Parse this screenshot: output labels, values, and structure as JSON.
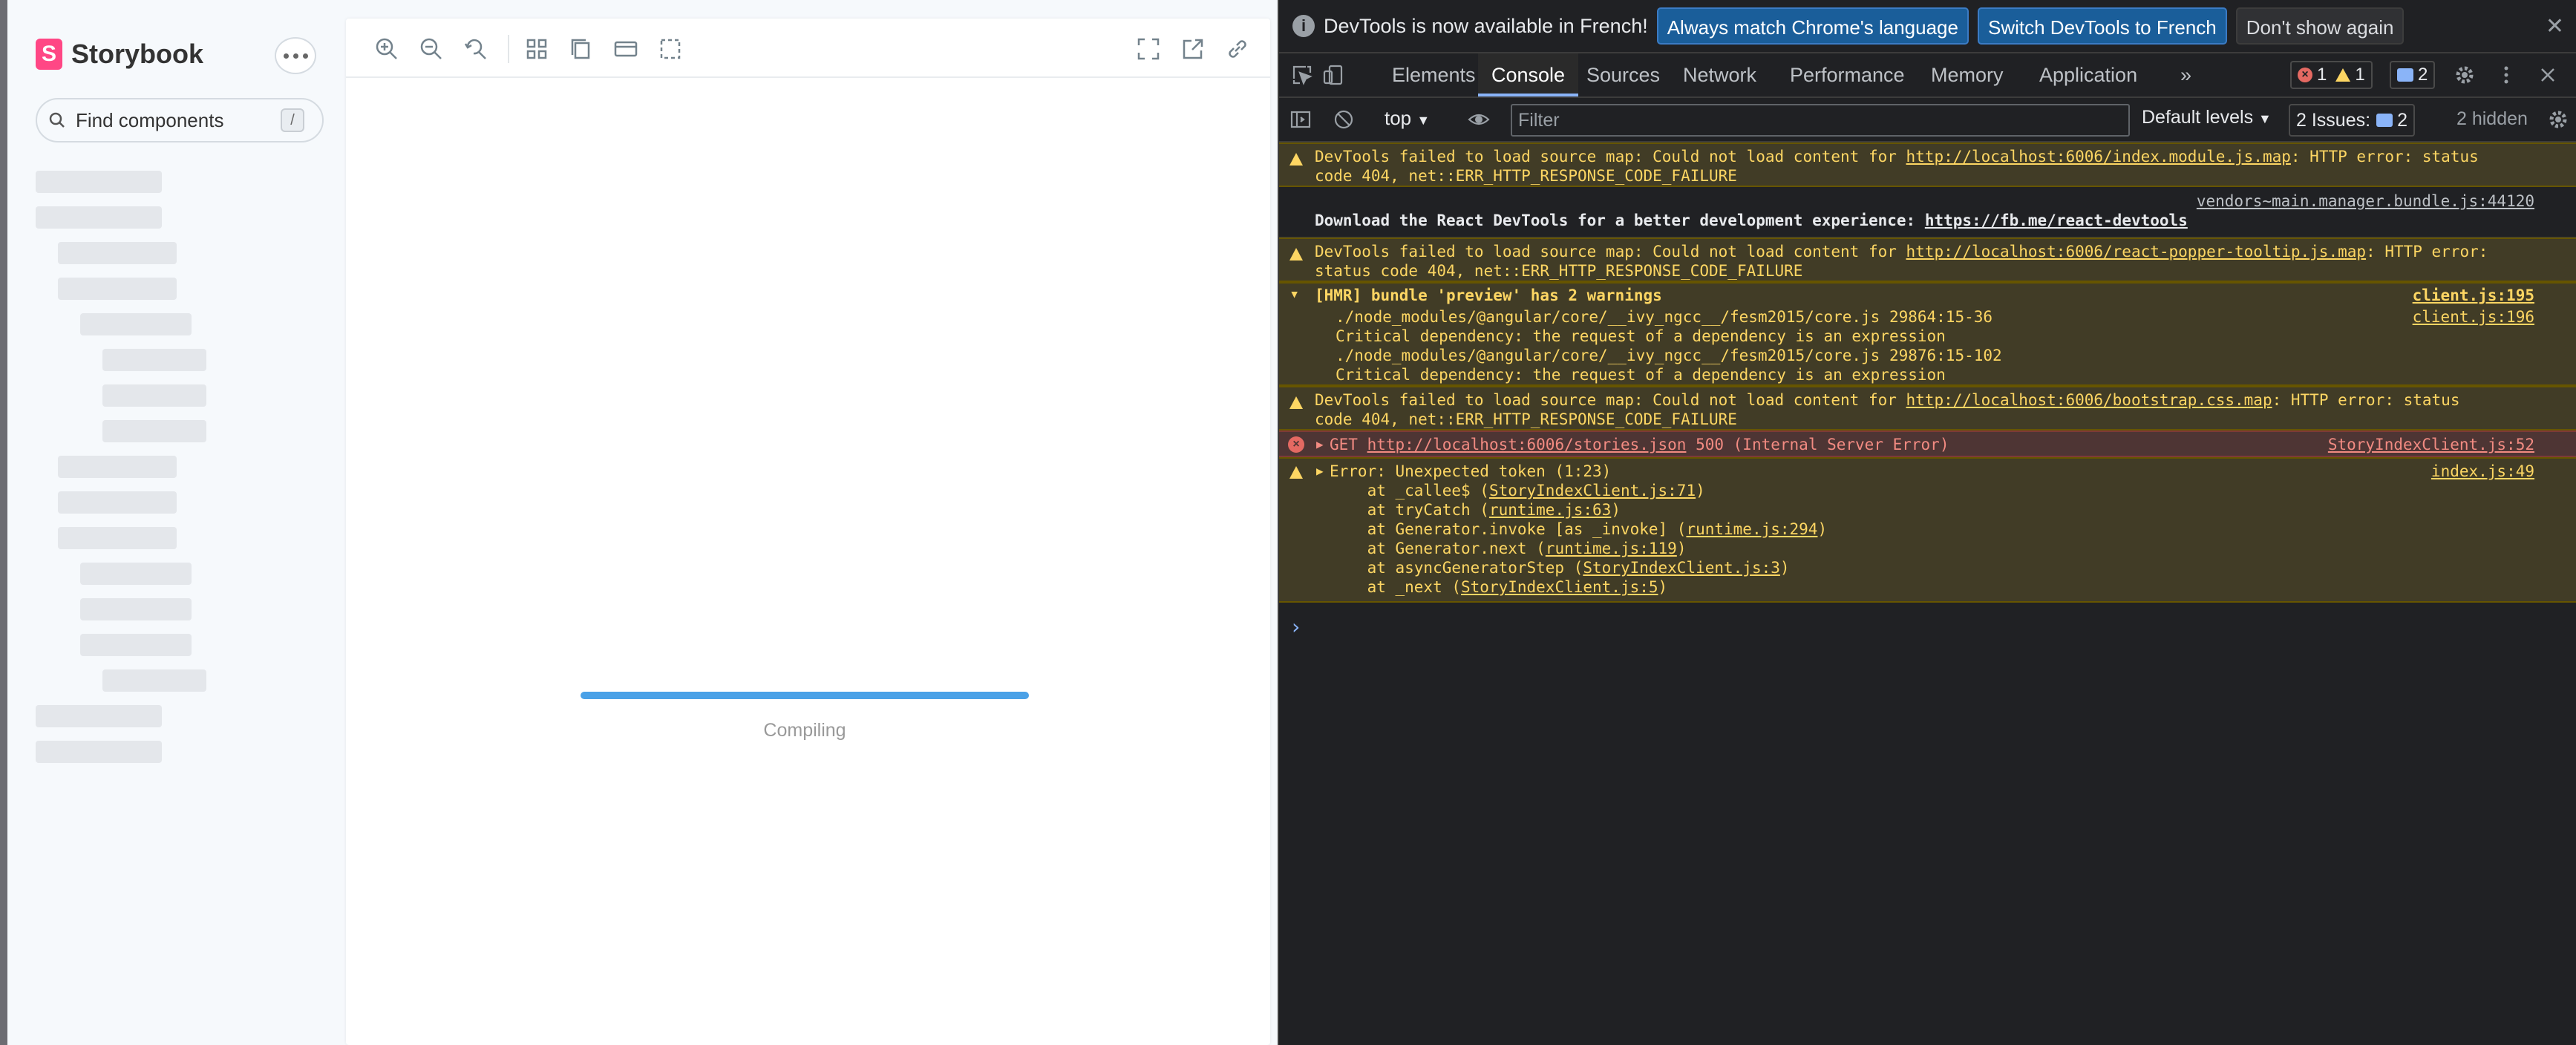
{
  "storybook": {
    "brand": "Storybook",
    "logo_letter": "S",
    "search_placeholder": "Find components",
    "search_shortcut": "/",
    "compiling": "Compiling",
    "progress": 1.0
  },
  "devtools": {
    "info_text": "DevTools is now available in French!",
    "info_btn_match": "Always match Chrome's language",
    "info_btn_switch": "Switch DevTools to French",
    "info_btn_dismiss": "Don't show again",
    "tabs": [
      "Elements",
      "Console",
      "Sources",
      "Network",
      "Performance",
      "Memory",
      "Application"
    ],
    "more_tabs": "»",
    "errors_count": "1",
    "warnings_count": "1",
    "messages_count": "2",
    "context": "top",
    "filter_placeholder": "Filter",
    "levels": "Default levels",
    "issues_label": "2 Issues:",
    "issues_count": "2",
    "hidden": "2 hidden"
  },
  "console": {
    "r1": {
      "l1a": "DevTools failed to load source map: Could not load content for ",
      "l1link": "http://localhost:6006/index.module.js.map",
      "l1b": ": HTTP error: status",
      "l2": "code 404, net::ERR_HTTP_RESPONSE_CODE_FAILURE"
    },
    "r2": {
      "src": "vendors~main.manager.bundle.js:44120",
      "text": "Download the React DevTools for a better development experience: ",
      "link": "https://fb.me/react-devtools"
    },
    "r3": {
      "l1a": "DevTools failed to load source map: Could not load content for ",
      "l1link": "http://localhost:6006/react-popper-tooltip.js.map",
      "l1b": ": HTTP error:",
      "l2": "status code 404, net::ERR_HTTP_RESPONSE_CODE_FAILURE"
    },
    "r4": {
      "text": "[HMR] bundle 'preview' has 2 warnings",
      "src": "client.js:195"
    },
    "r5": {
      "src": "client.js:196",
      "lines": [
        "./node_modules/@angular/core/__ivy_ngcc__/fesm2015/core.js 29864:15-36",
        "Critical dependency: the request of a dependency is an expression",
        "./node_modules/@angular/core/__ivy_ngcc__/fesm2015/core.js 29876:15-102",
        "Critical dependency: the request of a dependency is an expression"
      ]
    },
    "r6": {
      "l1a": "DevTools failed to load source map: Could not load content for ",
      "l1link": "http://localhost:6006/bootstrap.css.map",
      "l1b": ": HTTP error: status",
      "l2": "code 404, net::ERR_HTTP_RESPONSE_CODE_FAILURE"
    },
    "r7": {
      "method": "GET ",
      "link": "http://localhost:6006/stories.json",
      "rest": " 500 (Internal Server Error)",
      "src": "StoryIndexClient.js:52"
    },
    "r8": {
      "head": "Error: Unexpected token (1:23)",
      "src": "index.js:49",
      "frames": [
        {
          "pre": "    at _callee$ (",
          "link": "StoryIndexClient.js:71",
          "post": ")"
        },
        {
          "pre": "    at tryCatch (",
          "link": "runtime.js:63",
          "post": ")"
        },
        {
          "pre": "    at Generator.invoke [as _invoke] (",
          "link": "runtime.js:294",
          "post": ")"
        },
        {
          "pre": "    at Generator.next (",
          "link": "runtime.js:119",
          "post": ")"
        },
        {
          "pre": "    at asyncGeneratorStep (",
          "link": "StoryIndexClient.js:3",
          "post": ")"
        },
        {
          "pre": "    at _next (",
          "link": "StoryIndexClient.js:5",
          "post": ")"
        }
      ]
    },
    "prompt": "›"
  }
}
